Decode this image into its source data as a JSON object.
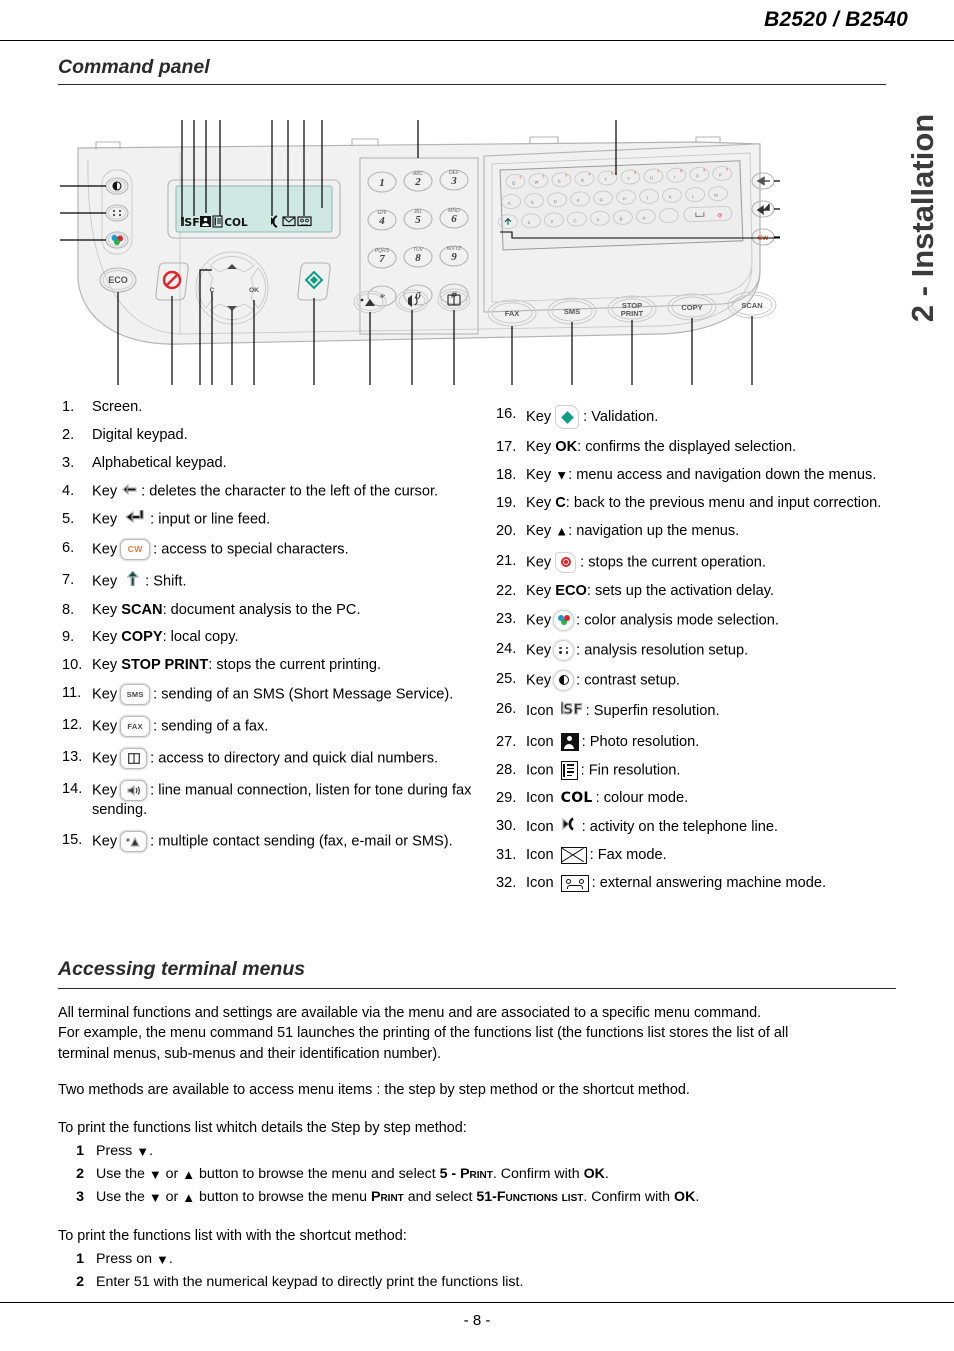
{
  "header": {
    "title": "B2520 / B2540"
  },
  "side_tab": {
    "label": "2 - Installation"
  },
  "sections": {
    "command_panel": "Command panel",
    "accessing_menus": "Accessing terminal menus"
  },
  "legend_left": [
    {
      "num": "1.",
      "pre": "Screen.",
      "icon": "",
      "post": ""
    },
    {
      "num": "2.",
      "pre": "Digital keypad.",
      "icon": "",
      "post": ""
    },
    {
      "num": "3.",
      "pre": "Alphabetical keypad.",
      "icon": "",
      "post": ""
    },
    {
      "num": "4.",
      "pre": "Key",
      "icon": "backspace-arrow",
      "post": ": deletes the character to the left of the cursor."
    },
    {
      "num": "5.",
      "pre": "Key",
      "icon": "enter-arrow",
      "post": ": input or line feed."
    },
    {
      "num": "6.",
      "pre": "Key",
      "icon": "cw-key",
      "post": ": access to special characters."
    },
    {
      "num": "7.",
      "pre": "Key",
      "icon": "shift-arrow",
      "post": ": Shift."
    },
    {
      "num": "8.",
      "pre": "Key",
      "icon": "",
      "bold": "SCAN",
      "post": ": document analysis to the PC."
    },
    {
      "num": "9.",
      "pre": "Key",
      "icon": "",
      "bold": "COPY",
      "post": ": local copy."
    },
    {
      "num": "10.",
      "pre": "Key",
      "icon": "",
      "bold": "STOP PRINT",
      "post": ": stops the current printing."
    },
    {
      "num": "11.",
      "pre": "Key",
      "icon": "sms-key",
      "post": ": sending of an SMS (Short Message Service)."
    },
    {
      "num": "12.",
      "pre": "Key",
      "icon": "fax-key",
      "post": ": sending of a fax."
    },
    {
      "num": "13.",
      "pre": "Key",
      "icon": "directory-key",
      "post": ": access to directory and quick dial numbers."
    },
    {
      "num": "14.",
      "pre": "Key",
      "icon": "speaker-key",
      "post": ": line manual connection, listen for tone during fax sending."
    },
    {
      "num": "15.",
      "pre": "Key",
      "icon": "multi-contact-key",
      "post": ": multiple contact sending (fax, e-mail or SMS)."
    }
  ],
  "legend_right": [
    {
      "num": "16.",
      "pre": "Key",
      "icon": "validation-key",
      "post": ": Validation."
    },
    {
      "num": "17.",
      "pre": "Key",
      "icon": "",
      "bold": "OK",
      "post": ": confirms the displayed selection."
    },
    {
      "num": "18.",
      "pre": "Key",
      "icon": "down-arrow",
      "post": ": menu access and navigation down the menus."
    },
    {
      "num": "19.",
      "pre": "Key",
      "icon": "",
      "bold": "C",
      "post": ": back to the previous menu and input correction."
    },
    {
      "num": "20.",
      "pre": "Key",
      "icon": "up-arrow",
      "post": ": navigation up the menus."
    },
    {
      "num": "21.",
      "pre": "Key",
      "icon": "stop-key",
      "post": ": stops the current operation."
    },
    {
      "num": "22.",
      "pre": "Key",
      "icon": "",
      "bold": "ECO",
      "post": ": sets up the activation delay."
    },
    {
      "num": "23.",
      "pre": "Key",
      "icon": "color-key",
      "post": ": color analysis mode selection."
    },
    {
      "num": "24.",
      "pre": "Key",
      "icon": "resolution-key",
      "post": ": analysis resolution setup."
    },
    {
      "num": "25.",
      "pre": "Key",
      "icon": "contrast-key",
      "post": ": contrast setup."
    },
    {
      "num": "26.",
      "pre": "Icon",
      "icon": "sf-icon",
      "post": ": Superfin resolution."
    },
    {
      "num": "27.",
      "pre": "Icon",
      "icon": "photo-icon",
      "post": ":  Photo resolution."
    },
    {
      "num": "28.",
      "pre": "Icon",
      "icon": "fin-icon",
      "post": ": Fin resolution."
    },
    {
      "num": "29.",
      "pre": "Icon",
      "icon": "col-icon",
      "post": ": colour mode."
    },
    {
      "num": "30.",
      "pre": "Icon",
      "icon": "line-activity-icon",
      "post": ": activity on the telephone line."
    },
    {
      "num": "31.",
      "pre": "Icon",
      "icon": "fax-mode-icon",
      "post": ": Fax mode."
    },
    {
      "num": "32.",
      "pre": "Icon",
      "icon": "answering-machine-icon",
      "post": ": external answering machine mode."
    }
  ],
  "menus": {
    "p1_line1": "All terminal functions and settings are available via the menu and are associated to a specific menu command.",
    "p1_line2": "For example, the menu command 51 launches the printing of the functions list (the functions list stores the list of all",
    "p1_line3": "terminal menus, sub-menus and their identification number).",
    "p2": "Two methods are available to access menu items : the step by step method or the shortcut method.",
    "p3": "To print  the functions list whitch details the Step by step method:",
    "steps_a": [
      {
        "n": "1",
        "t1": "Press ",
        "t2": "."
      },
      {
        "n": "2",
        "t1": "Use the ",
        "t2": " or ",
        "t3": " button to browse the menu and select  ",
        "sc1": "5 - Print",
        "t4": ". Confirm with ",
        "b1": "OK",
        "t5": "."
      },
      {
        "n": "3",
        "t1": "Use the ",
        "t2": " or ",
        "t3": " button to browse the menu ",
        "sc1": "Print",
        "t4": " and select ",
        "sc2": "51-Functions list",
        "t5": ". Confirm with ",
        "b1": "OK",
        "t6": "."
      }
    ],
    "p4": "To print  the functions list with with the shortcut method:",
    "steps_b": [
      {
        "n": "1",
        "t1": "Press on ",
        "t2": "."
      },
      {
        "n": "2",
        "t1": "Enter 51 with the numerical keypad to directly print the functions list."
      }
    ]
  },
  "panel_diagram": {
    "lcd_status": [
      "SF",
      "photo",
      "fin",
      "COL",
      "line",
      "fax",
      "ans"
    ],
    "keypad_digits": [
      {
        "d": "1",
        "l": ""
      },
      {
        "d": "2",
        "l": "ABC"
      },
      {
        "d": "3",
        "l": "DEF"
      },
      {
        "d": "4",
        "l": "GHI"
      },
      {
        "d": "5",
        "l": "JKL"
      },
      {
        "d": "6",
        "l": "MNO"
      },
      {
        "d": "7",
        "l": "PQRS"
      },
      {
        "d": "8",
        "l": "TUV"
      },
      {
        "d": "9",
        "l": "WXYZ"
      },
      {
        "d": "*",
        "l": ""
      },
      {
        "d": "0",
        "l": ""
      },
      {
        "d": "#",
        "l": ""
      }
    ],
    "alpha_rows": [
      [
        "Q",
        "W",
        "E",
        "R",
        "T",
        "Y",
        "U",
        "I",
        "O",
        "P"
      ],
      [
        "A",
        "S",
        "D",
        "F",
        "G",
        "H",
        "J",
        "K",
        "L",
        "M"
      ],
      [
        "Z",
        "X",
        "C",
        "V",
        "B",
        "N"
      ]
    ],
    "function_keys": [
      "FAX",
      "SMS",
      "STOP PRINT",
      "COPY",
      "SCAN"
    ],
    "eco_label": "ECO",
    "nav_labels": {
      "c": "C",
      "ok": "OK"
    }
  },
  "footer": {
    "page": "- 8 -"
  },
  "colors": {
    "accent_teal": "#0f9d84",
    "accent_red": "#e2232a",
    "accent_orange": "#ef7c45",
    "lcd_green": "#cfe9e2",
    "panel_gray": "#efefef"
  }
}
